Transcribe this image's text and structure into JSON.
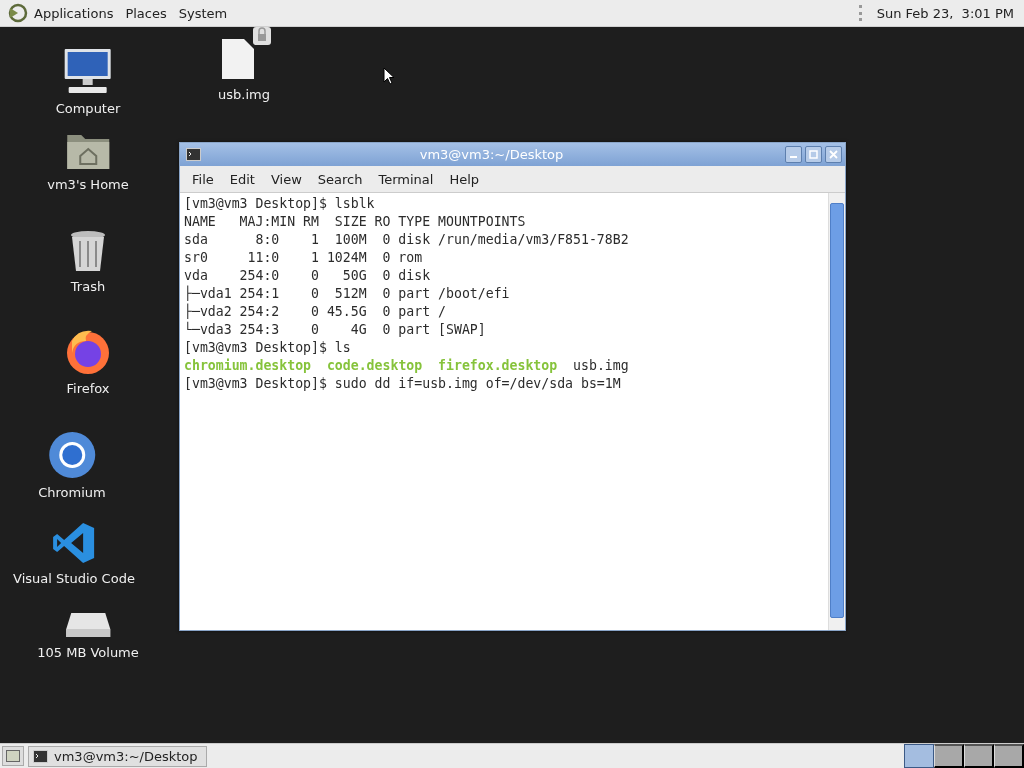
{
  "top_panel": {
    "menus": [
      "Applications",
      "Places",
      "System"
    ],
    "clock": "Sun Feb 23,  3:01 PM"
  },
  "desktop_icons": [
    {
      "label": "Computer",
      "kind": "computer"
    },
    {
      "label": "usb.img",
      "kind": "file"
    },
    {
      "label": "vm3's Home",
      "kind": "home"
    },
    {
      "label": "Trash",
      "kind": "trash"
    },
    {
      "label": "Firefox",
      "kind": "firefox"
    },
    {
      "label": "Chromium",
      "kind": "chromium"
    },
    {
      "label": "Visual Studio Code",
      "kind": "vscode"
    },
    {
      "label": "105 MB Volume",
      "kind": "drive"
    }
  ],
  "terminal": {
    "title": "vm3@vm3:~/Desktop",
    "menu": [
      "File",
      "Edit",
      "View",
      "Search",
      "Terminal",
      "Help"
    ],
    "lines": [
      [
        {
          "text": "[vm3@vm3 Desktop]$ lsblk",
          "kind": "plain"
        }
      ],
      [
        {
          "text": "NAME   MAJ:MIN RM  SIZE RO TYPE MOUNTPOINTS",
          "kind": "plain"
        }
      ],
      [
        {
          "text": "sda      8:0    1  100M  0 disk /run/media/vm3/F851-78B2",
          "kind": "plain"
        }
      ],
      [
        {
          "text": "sr0     11:0    1 1024M  0 rom",
          "kind": "plain"
        }
      ],
      [
        {
          "text": "vda    254:0    0   50G  0 disk",
          "kind": "plain"
        }
      ],
      [
        {
          "text": "├─vda1 254:1    0  512M  0 part /boot/efi",
          "kind": "plain"
        }
      ],
      [
        {
          "text": "├─vda2 254:2    0 45.5G  0 part /",
          "kind": "plain"
        }
      ],
      [
        {
          "text": "└─vda3 254:3    0    4G  0 part [SWAP]",
          "kind": "plain"
        }
      ],
      [
        {
          "text": "[vm3@vm3 Desktop]$ ls",
          "kind": "plain"
        }
      ],
      [
        {
          "text": "chromium.desktop",
          "kind": "executable"
        },
        {
          "text": "  code.desktop",
          "kind": "executable"
        },
        {
          "text": "  firefox.desktop",
          "kind": "executable"
        },
        {
          "text": "  usb.img",
          "kind": "plain"
        }
      ],
      [
        {
          "text": "[vm3@vm3 Desktop]$ sudo dd if=usb.img of=/dev/sda bs=1M",
          "kind": "plain"
        }
      ]
    ]
  },
  "taskbar": {
    "tasks": [
      {
        "label": "vm3@vm3:~/Desktop",
        "selected": false
      }
    ],
    "workspaces": [
      {
        "selected": true
      },
      {
        "selected": false
      },
      {
        "selected": false
      },
      {
        "selected": false
      }
    ]
  }
}
